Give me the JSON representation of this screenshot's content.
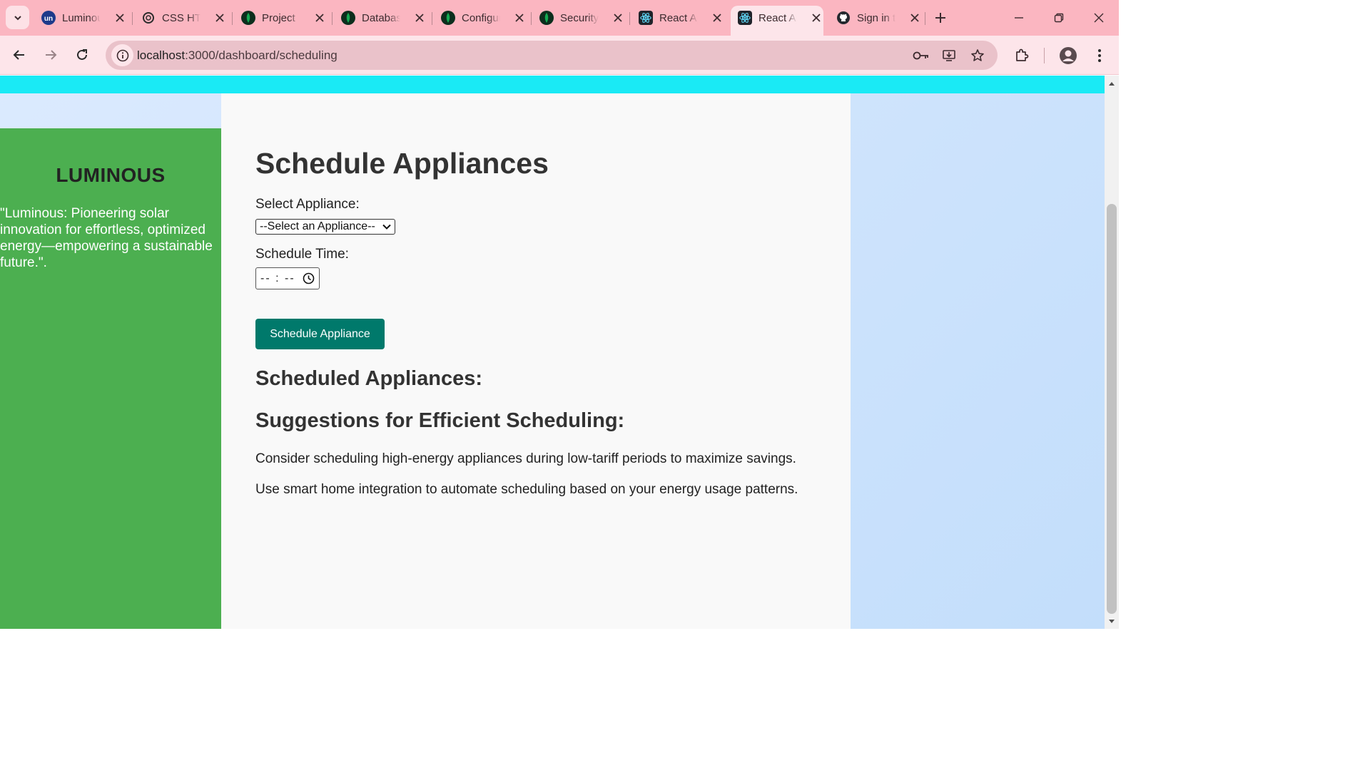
{
  "browser": {
    "tabs": [
      {
        "title": "Luminous",
        "favicon": "un-logo-icon",
        "active": false
      },
      {
        "title": "CSS HTML",
        "favicon": "chatgpt-icon",
        "active": false
      },
      {
        "title": "Project",
        "favicon": "mongodb-leaf-icon",
        "active": false
      },
      {
        "title": "Database",
        "favicon": "mongodb-leaf-icon",
        "active": false
      },
      {
        "title": "Configure",
        "favicon": "mongodb-leaf-icon",
        "active": false
      },
      {
        "title": "Security",
        "favicon": "mongodb-leaf-icon",
        "active": false
      },
      {
        "title": "React App",
        "favicon": "react-icon",
        "active": false
      },
      {
        "title": "React App",
        "favicon": "react-icon",
        "active": true
      },
      {
        "title": "Sign in to GitHub",
        "favicon": "github-icon",
        "active": false
      }
    ],
    "address": {
      "host": "localhost",
      "path": ":3000/dashboard/scheduling"
    },
    "colors": {
      "tabbar": "#fbb6c1",
      "toolbar": "#fde5ea",
      "omnibox": "#eac2ca"
    }
  },
  "sidebar": {
    "brand": "LUMINOUS",
    "tagline": "\"Luminous: Pioneering solar innovation for effortless, optimized energy—empowering a sustainable future.\"."
  },
  "main": {
    "title": "Schedule Appliances",
    "appliance_label": "Select Appliance:",
    "appliance_selected": "--Select an Appliance--",
    "time_label": "Schedule Time:",
    "time_placeholder": "-- : --",
    "submit_label": "Schedule Appliance",
    "scheduled_heading": "Scheduled Appliances:",
    "suggestions_heading": "Suggestions for Efficient Scheduling:",
    "suggestions": [
      "Consider scheduling high-energy appliances during low-tariff periods to maximize savings.",
      "Use smart home integration to automate scheduling based on your energy usage patterns."
    ]
  },
  "colors": {
    "top_strip": "#1aeaf5",
    "sidebar": "#4caf50",
    "content": "#f9f9f9",
    "button": "#00796b",
    "background": "#c9e2fb"
  }
}
